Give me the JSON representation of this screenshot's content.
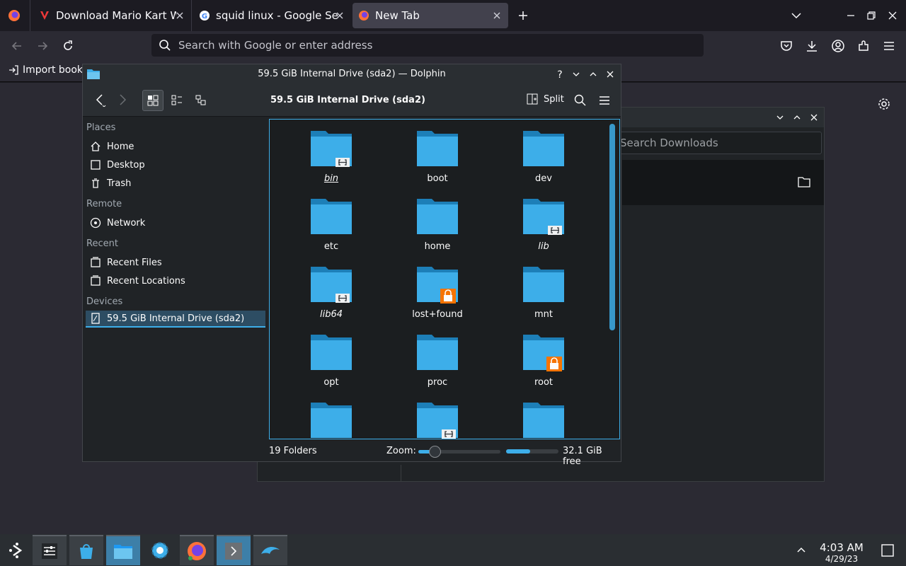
{
  "browser": {
    "tabs": [
      {
        "title": "Download Mario Kart Wii",
        "icon": "vivaldi-icon"
      },
      {
        "title": "squid linux - Google Search",
        "icon": "google-icon"
      },
      {
        "title": "New Tab",
        "icon": "firefox-icon"
      }
    ],
    "url_placeholder": "Search with Google or enter address",
    "bookmark": "Import bookmarks..."
  },
  "bg_window": {
    "search_placeholder": "Search Downloads"
  },
  "dolphin": {
    "window_title": "59.5 GiB Internal Drive (sda2) — Dolphin",
    "location": "59.5 GiB Internal Drive (sda2)",
    "split_label": "Split",
    "sidebar": {
      "places_header": "Places",
      "places": [
        "Home",
        "Desktop",
        "Trash"
      ],
      "remote_header": "Remote",
      "remote": [
        "Network"
      ],
      "recent_header": "Recent",
      "recent": [
        "Recent Files",
        "Recent Locations"
      ],
      "devices_header": "Devices",
      "devices": [
        "59.5 GiB Internal Drive (sda2)"
      ]
    },
    "folders": [
      {
        "name": "bin",
        "badge": "link",
        "italic": true
      },
      {
        "name": "boot",
        "badge": "",
        "italic": false
      },
      {
        "name": "dev",
        "badge": "",
        "italic": false
      },
      {
        "name": "etc",
        "badge": "",
        "italic": false
      },
      {
        "name": "home",
        "badge": "",
        "italic": false
      },
      {
        "name": "lib",
        "badge": "link",
        "italic": true
      },
      {
        "name": "lib64",
        "badge": "link",
        "italic": true
      },
      {
        "name": "lost+found",
        "badge": "lock",
        "italic": false
      },
      {
        "name": "mnt",
        "badge": "",
        "italic": false
      },
      {
        "name": "opt",
        "badge": "",
        "italic": false
      },
      {
        "name": "proc",
        "badge": "",
        "italic": false
      },
      {
        "name": "root",
        "badge": "lock",
        "italic": false
      },
      {
        "name": "",
        "badge": "",
        "italic": false
      },
      {
        "name": "",
        "badge": "link",
        "italic": false
      },
      {
        "name": "",
        "badge": "",
        "italic": false
      }
    ],
    "status": {
      "count": "19 Folders",
      "zoom_label": "Zoom:",
      "free": "32.1 GiB free",
      "zoom_level": 0.2,
      "free_fraction": 0.46
    }
  },
  "taskbar": {
    "time": "4:03 AM",
    "date": "4/29/23"
  },
  "colors": {
    "folder": "#3daee9",
    "accent": "#3daee9",
    "lock": "#f67400"
  }
}
